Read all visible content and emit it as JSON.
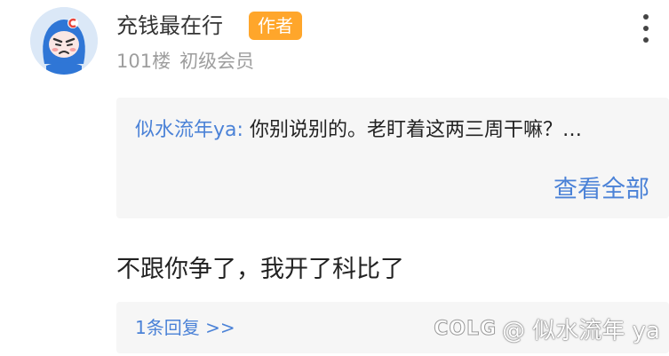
{
  "comment": {
    "username": "充钱最在行",
    "badge": "作者",
    "floor": "101楼",
    "level": "初级会员",
    "text": "不跟你争了，我开了科比了"
  },
  "quote": {
    "user": "似水流年ya",
    "colon": ":",
    "text": "你别说别的。老盯着这两三周干嘛？…",
    "view_all": "查看全部"
  },
  "replies": {
    "label": "1条回复 >>"
  },
  "watermark": {
    "logo": "COLG",
    "text": "@ 似水流年 ya"
  },
  "icons": {
    "more": "more-vertical-icon",
    "avatar": "avatar-icon"
  },
  "colors": {
    "accent_blue": "#4b82d7",
    "badge_orange": "#ffa62b",
    "panel_bg": "#f6f6f6"
  }
}
